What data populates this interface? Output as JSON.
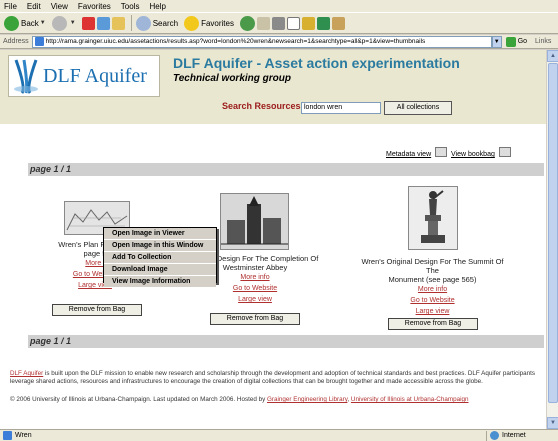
{
  "menu": [
    "File",
    "Edit",
    "View",
    "Favorites",
    "Tools",
    "Help"
  ],
  "toolbar": {
    "back": "Back",
    "search": "Search",
    "favorites": "Favorites"
  },
  "address": {
    "label": "Address",
    "url": "http://rama.grainger.uiuc.edu/assetactions/results.asp?word=london%20wren&newsearch=1&searchtype=all&p=1&view=thumbnails",
    "go": "Go",
    "links": "Links"
  },
  "site": {
    "logo_text": "DLF Aquifer",
    "title": "DLF Aquifer - Asset action experimentation",
    "subtitle": "Technical working group"
  },
  "search": {
    "label": "Search Resources",
    "value": "london wren",
    "collections_button": "All collections"
  },
  "links": {
    "metadata_view": "Metadata view",
    "view_bookbag": "View bookbag"
  },
  "pager": {
    "top": "page 1 / 1",
    "bottom": "page 1 / 1"
  },
  "context_menu": [
    "Open Image in Viewer",
    "Open Image in this Window",
    "Add To Collection",
    "Download Image",
    "View Image Information"
  ],
  "items": [
    {
      "title_line1": "Wren's Plan For Rebu",
      "title_line2": "page 5",
      "more_info": "More i",
      "website": "Go to Website",
      "large_view": "Large view",
      "remove": "Remove from Bag"
    },
    {
      "title_line1": "Wren's Design For The Completion Of",
      "title_line2": "Westminster Abbey",
      "more_info": "More info",
      "website": "Go to Website",
      "large_view": "Large view",
      "remove": "Remove from Bag"
    },
    {
      "title_line1": "Wren's Original Design For The Summit Of The",
      "title_line2": "Monument (see page 565)",
      "more_info": "More info",
      "website": "Go to Website",
      "large_view": "Large view",
      "remove": "Remove from Bag"
    }
  ],
  "footer": {
    "aquifer_link": "DLF Aquifer",
    "mission": "is built upon the DLF mission to enable new research and scholarship through the development and adoption of technical standards and best practices. DLF Aquifer participants leverage shared actions, resources and infrastructures to encourage the creation of digital collections that can be brought together and made accessible across the globe.",
    "copyright": "© 2006 University of Illinois at Urbana-Champaign. Last updated on March 2006. Hosted by",
    "library_link": "Grainger Engineering Library",
    "univ_link": "University of Illinois at Urbana-Champaign",
    "comma": ","
  },
  "status": {
    "text": "Wren",
    "zone": "Internet"
  }
}
